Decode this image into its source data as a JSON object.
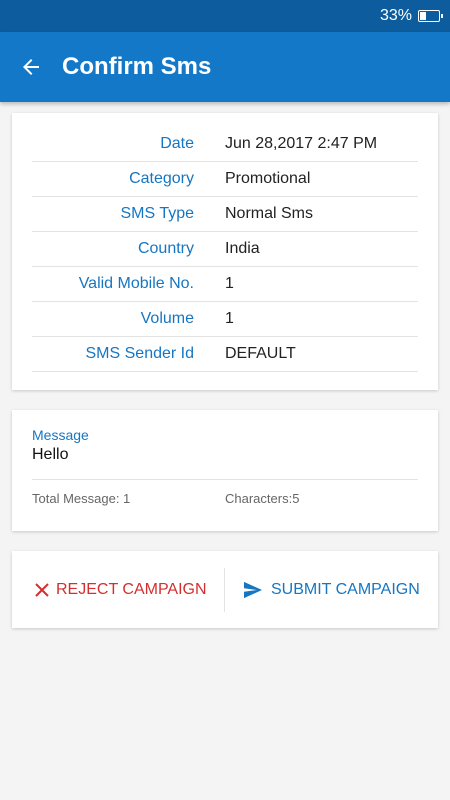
{
  "status_bar": {
    "battery_text": "33%",
    "battery_level": 0.33
  },
  "header": {
    "title": "Confirm Sms"
  },
  "details": [
    {
      "label": "Date",
      "value": "Jun 28,2017 2:47 PM"
    },
    {
      "label": "Category",
      "value": "Promotional"
    },
    {
      "label": "SMS Type",
      "value": "Normal Sms"
    },
    {
      "label": "Country",
      "value": "India"
    },
    {
      "label": "Valid Mobile No.",
      "value": "1"
    },
    {
      "label": "Volume",
      "value": "1"
    },
    {
      "label": "SMS Sender Id",
      "value": "DEFAULT"
    }
  ],
  "message": {
    "label": "Message",
    "text": "Hello",
    "total": "Total Message: 1",
    "characters": "Characters:5"
  },
  "actions": {
    "reject_label": "REJECT CAMPAIGN",
    "submit_label": "SUBMIT CAMPAIGN"
  },
  "colors": {
    "primary": "#1478c8",
    "status_bar": "#0d5d9e",
    "label_blue": "#1676c2",
    "reject_red": "#d32f2f"
  }
}
